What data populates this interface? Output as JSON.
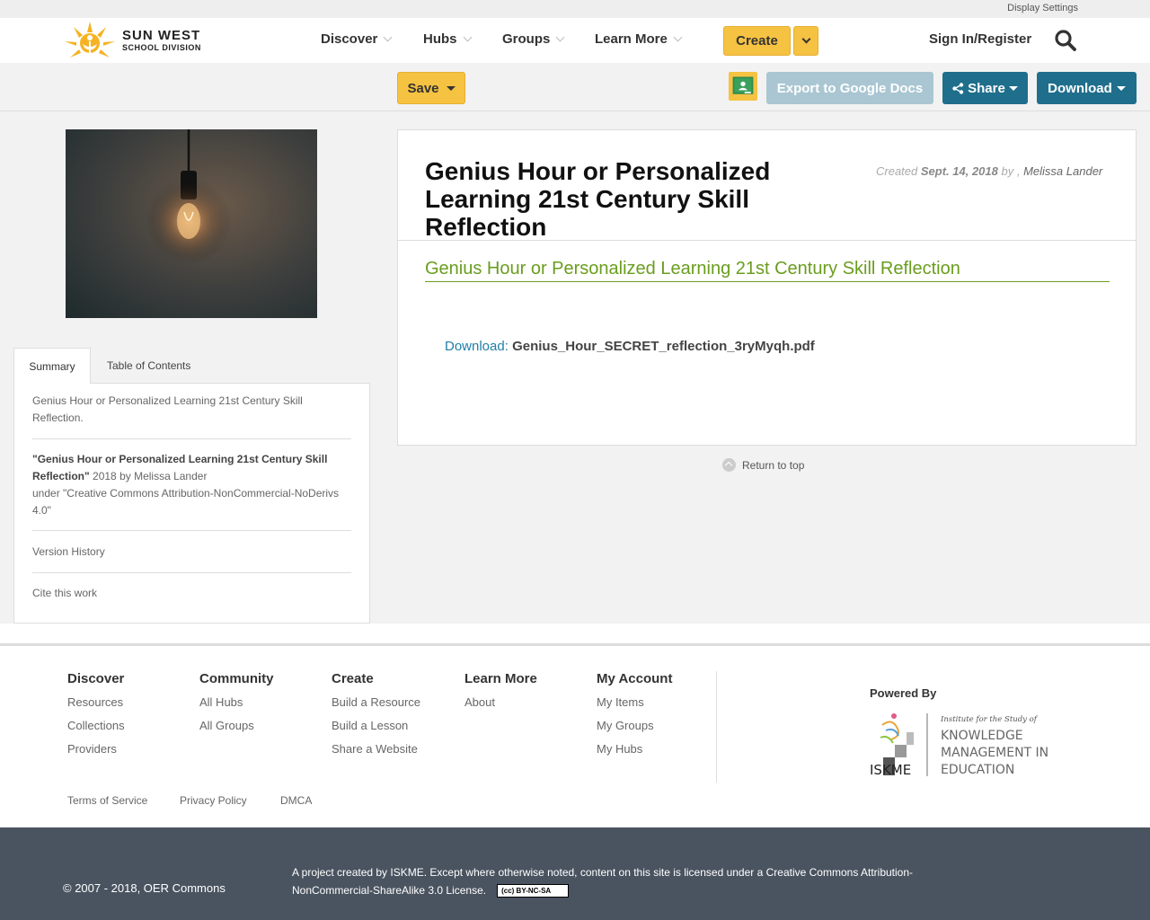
{
  "util": {
    "display_settings": "Display Settings"
  },
  "logo": {
    "line1": "SUN WEST",
    "line2": "SCHOOL DIVISION"
  },
  "nav": {
    "discover": "Discover",
    "hubs": "Hubs",
    "groups": "Groups",
    "learn_more": "Learn More",
    "create": "Create",
    "sign_in": "Sign In/Register"
  },
  "toolbar": {
    "save": "Save",
    "export": "Export to Google Docs",
    "share": "Share",
    "download": "Download"
  },
  "tabs": {
    "summary": "Summary",
    "toc": "Table of Contents"
  },
  "summary": {
    "description": "Genius Hour or Personalized Learning 21st Century Skill Reflection.",
    "attr_title": "\"Genius Hour or Personalized Learning 21st Century Skill Reflection\"",
    "attr_rest": " 2018 by Melissa Lander",
    "attr_license": "under \"Creative Commons Attribution-NonCommercial-NoDerivs 4.0\"",
    "version_history": "Version History",
    "cite": "Cite this work"
  },
  "resource": {
    "title": "Genius Hour or Personalized Learning 21st Century Skill Reflection",
    "created_label": "Created",
    "created_date": "Sept. 14, 2018",
    "by_label": "by ,",
    "author": "Melissa Lander",
    "link_text": "Genius Hour or Personalized Learning 21st Century Skill Reflection",
    "download_label": "Download:",
    "file_name": "Genius_Hour_SECRET_reflection_3ryMyqh.pdf",
    "return_top": "Return to top"
  },
  "footer": {
    "discover": {
      "heading": "Discover",
      "links": [
        "Resources",
        "Collections",
        "Providers"
      ]
    },
    "community": {
      "heading": "Community",
      "links": [
        "All Hubs",
        "All Groups"
      ]
    },
    "create": {
      "heading": "Create",
      "links": [
        "Build a Resource",
        "Build a Lesson",
        "Share a Website"
      ]
    },
    "learn_more": {
      "heading": "Learn More",
      "links": [
        "About"
      ]
    },
    "my_account": {
      "heading": "My Account",
      "links": [
        "My Items",
        "My Groups",
        "My Hubs"
      ]
    },
    "powered_by": "Powered By",
    "iskme_tagline": "Institute for the Study of",
    "iskme_l1": "KNOWLEDGE",
    "iskme_l2": "MANAGEMENT IN",
    "iskme_l3": "EDUCATION",
    "iskme_abbr": "ISKME",
    "terms": "Terms of Service",
    "privacy": "Privacy Policy",
    "dmca": "DMCA"
  },
  "bottom": {
    "copyright": "© 2007 - 2018, OER Commons",
    "license": "A project created by ISKME. Except where otherwise noted, content on this site is licensed under a Creative Commons Attribution-NonCommercial-ShareAlike 3.0 License.",
    "cc_badge": "(cc) BY-NC-SA"
  },
  "colors": {
    "accent_yellow": "#f5c242",
    "primary_blue": "#1f6e8c",
    "export_disabled": "#a9c6d2",
    "link_green": "#6a9d1e",
    "link_blue": "#1f7ea6",
    "footer_dark": "#4a5460"
  },
  "icons": {
    "search": "search-icon",
    "share": "share-icon",
    "classroom": "google-classroom-icon",
    "return_top": "arrow-up-circle-icon"
  }
}
